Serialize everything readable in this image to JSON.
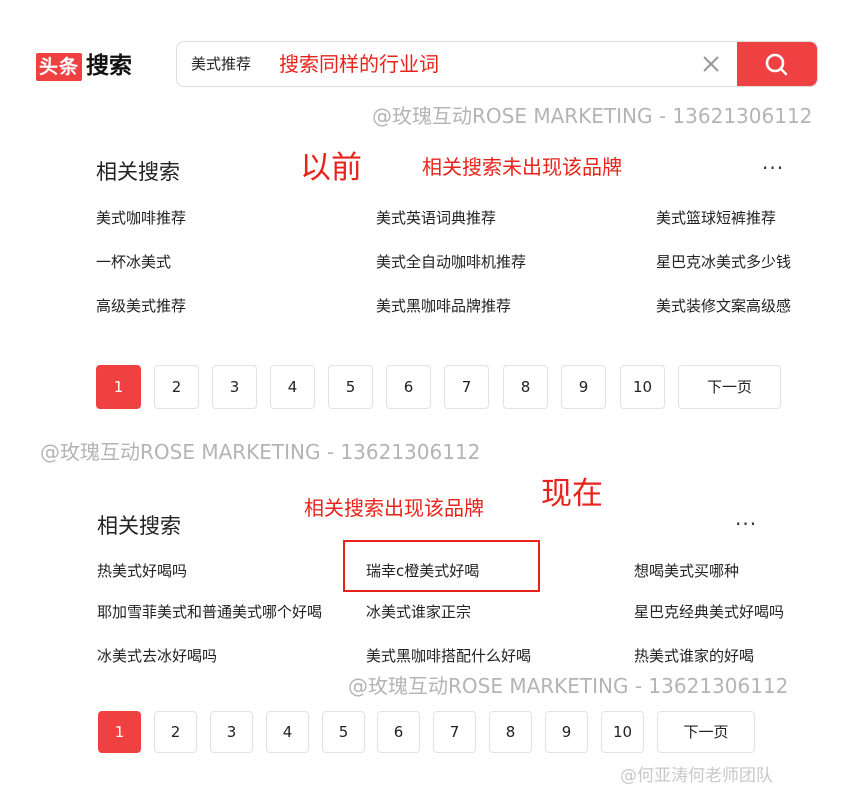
{
  "brand": {
    "logo_box": "头条",
    "logo_text": "搜索"
  },
  "search": {
    "query": "美式推荐",
    "note": "搜索同样的行业词"
  },
  "watermark": "@玫瑰互动ROSE MARKETING - 13621306112",
  "before": {
    "title": "相关搜索",
    "tag": "以前",
    "note": "相关搜索未出现该品牌",
    "more": "···",
    "links": [
      [
        "美式咖啡推荐",
        "美式英语词典推荐",
        "美式篮球短裤推荐"
      ],
      [
        "一杯冰美式",
        "美式全自动咖啡机推荐",
        "星巴克冰美式多少钱"
      ],
      [
        "高级美式推荐",
        "美式黑咖啡品牌推荐",
        "美式装修文案高级感"
      ]
    ]
  },
  "after": {
    "title": "相关搜索",
    "tag": "现在",
    "note": "相关搜索出现该品牌",
    "more": "···",
    "links": [
      [
        "热美式好喝吗",
        "瑞幸c橙美式好喝",
        "想喝美式买哪种"
      ],
      [
        "耶加雪菲美式和普通美式哪个好喝",
        "冰美式谁家正宗",
        "星巴克经典美式好喝吗"
      ],
      [
        "冰美式去冰好喝吗",
        "美式黑咖啡搭配什么好喝",
        "热美式谁家的好喝"
      ]
    ]
  },
  "pager": {
    "pages": [
      "1",
      "2",
      "3",
      "4",
      "5",
      "6",
      "7",
      "8",
      "9",
      "10"
    ],
    "next": "下一页",
    "current": 1
  },
  "footer": "@何亚涛何老师团队",
  "colors": {
    "accent": "#f04142",
    "annotation": "#e8231b",
    "watermark": "#b4b4b4"
  }
}
